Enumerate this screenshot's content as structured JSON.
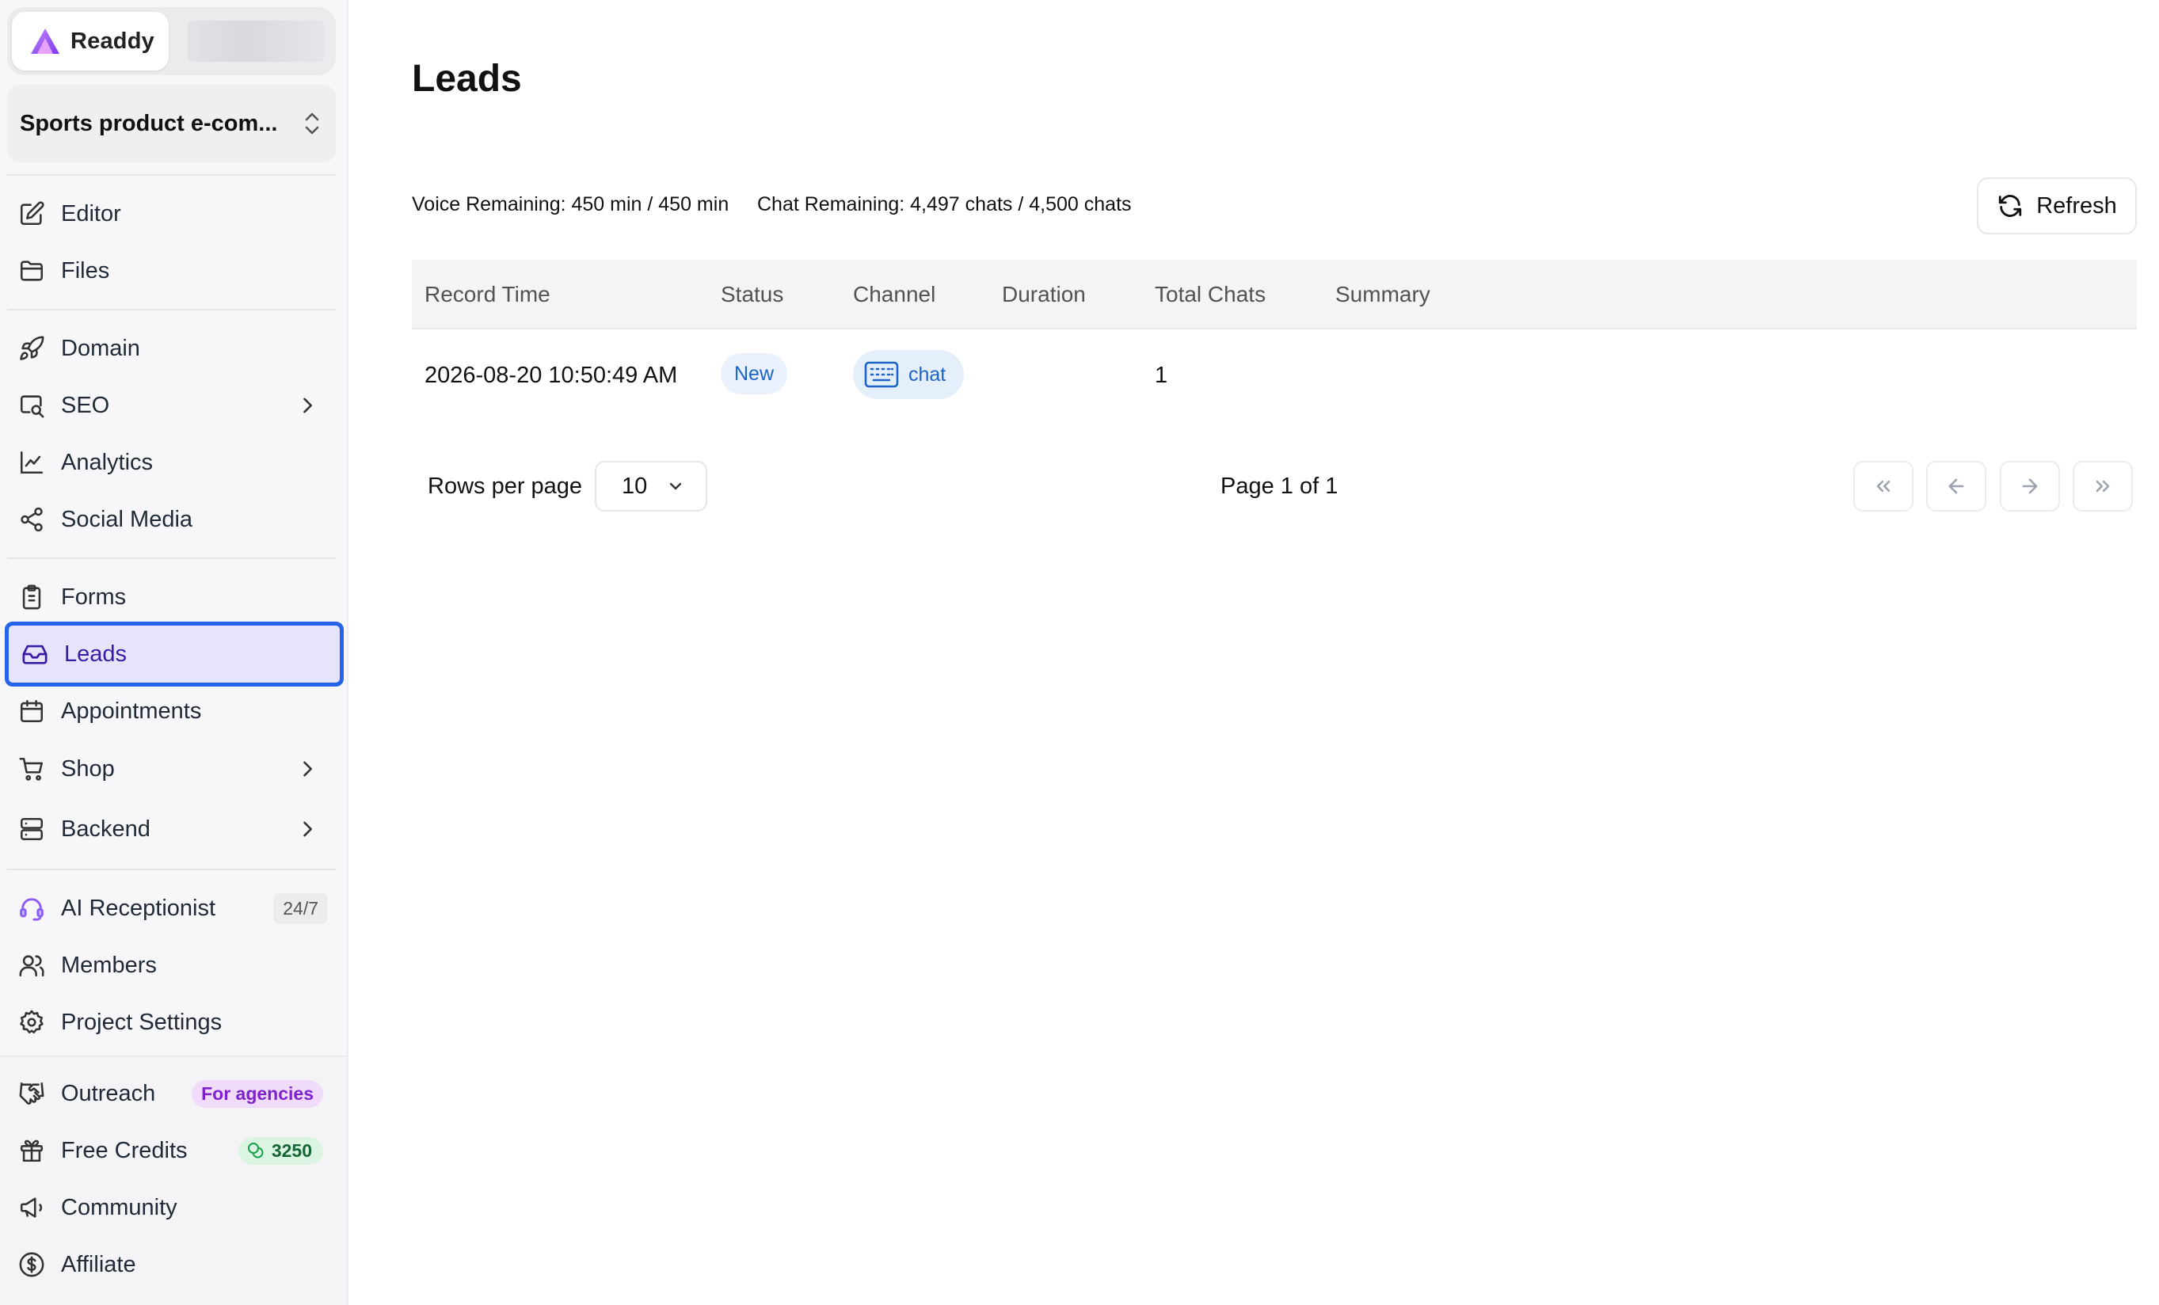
{
  "brand": {
    "name": "Readdy"
  },
  "project": {
    "name": "Sports product e-com..."
  },
  "sidebar": {
    "group1": [
      {
        "label": "Editor",
        "icon": "edit-icon"
      },
      {
        "label": "Files",
        "icon": "folder-icon"
      }
    ],
    "group2": [
      {
        "label": "Domain",
        "icon": "rocket-icon"
      },
      {
        "label": "SEO",
        "icon": "search-icon"
      },
      {
        "label": "Analytics",
        "icon": "chart-line-icon"
      },
      {
        "label": "Social Media",
        "icon": "share-icon"
      }
    ],
    "group3": [
      {
        "label": "Forms",
        "icon": "clipboard-icon"
      },
      {
        "label": "Leads",
        "icon": "inbox-icon"
      },
      {
        "label": "Appointments",
        "icon": "calendar-icon"
      },
      {
        "label": "Shop",
        "icon": "cart-icon"
      },
      {
        "label": "Backend",
        "icon": "server-icon"
      }
    ],
    "group4": [
      {
        "label": "AI Receptionist",
        "icon": "headset-icon",
        "badge": "24/7"
      },
      {
        "label": "Members",
        "icon": "users-icon"
      },
      {
        "label": "Project Settings",
        "icon": "gear-icon"
      }
    ],
    "bottom": [
      {
        "label": "Outreach",
        "icon": "handshake-icon",
        "badge": "For agencies"
      },
      {
        "label": "Free Credits",
        "icon": "gift-icon",
        "badge": "3250"
      },
      {
        "label": "Community",
        "icon": "megaphone-icon"
      },
      {
        "label": "Affiliate",
        "icon": "dollar-icon"
      }
    ],
    "active": "Leads"
  },
  "main": {
    "title": "Leads",
    "voice_remaining": "Voice Remaining: 450 min / 450 min",
    "chat_remaining": "Chat Remaining: 4,497 chats / 4,500 chats",
    "refresh_label": "Refresh",
    "columns": [
      "Record Time",
      "Status",
      "Channel",
      "Duration",
      "Total Chats",
      "Summary"
    ],
    "rows": [
      {
        "record_time": "2026-08-20 10:50:49 AM",
        "status": "New",
        "channel": "chat",
        "duration": "",
        "total_chats": "1",
        "summary": ""
      }
    ],
    "pagination": {
      "rows_per_page_label": "Rows per page",
      "rows_per_page": "10",
      "page_info": "Page 1 of 1"
    }
  },
  "colors": {
    "accent": "#2563eb",
    "active_bg": "#e5e4fb",
    "status_blue": "#1d64c9",
    "badge_purple": "#7e22ce",
    "badge_green": "#166534"
  }
}
